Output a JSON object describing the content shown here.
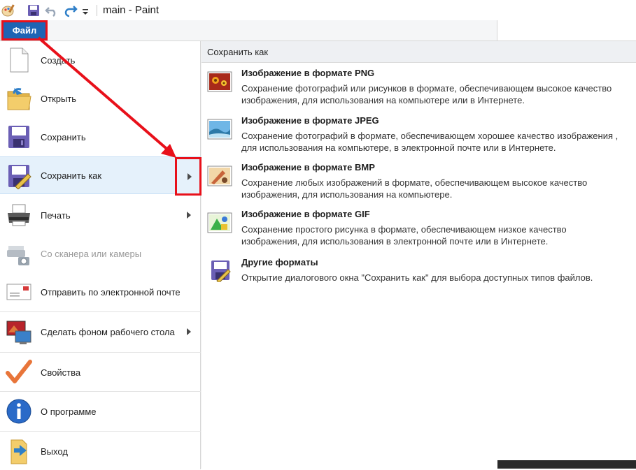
{
  "window": {
    "title": "main - Paint"
  },
  "quick_access": {
    "icons": [
      "paint-app-icon",
      "save-icon",
      "undo-icon",
      "redo-icon",
      "customize-dropdown-icon"
    ]
  },
  "file_tab": {
    "label": "Файл"
  },
  "menu": {
    "items": [
      {
        "label": "Создать",
        "icon": "new-document-icon",
        "enabled": true,
        "has_submenu": false
      },
      {
        "label": "Открыть",
        "icon": "open-folder-icon",
        "enabled": true,
        "has_submenu": false
      },
      {
        "label": "Сохранить",
        "icon": "save-icon",
        "enabled": true,
        "has_submenu": false
      },
      {
        "label": "Сохранить как",
        "icon": "save-as-icon",
        "enabled": true,
        "has_submenu": true,
        "active": true
      },
      {
        "label": "Печать",
        "icon": "printer-icon",
        "enabled": true,
        "has_submenu": true
      },
      {
        "label": "Со сканера или камеры",
        "icon": "scanner-icon",
        "enabled": false,
        "has_submenu": false
      },
      {
        "label": "Отправить по электронной почте",
        "icon": "email-icon",
        "enabled": true,
        "has_submenu": false
      },
      {
        "label": "Сделать фоном рабочего стола",
        "icon": "desktop-background-icon",
        "enabled": true,
        "has_submenu": true
      },
      {
        "label": "Свойства",
        "icon": "checkmark-icon",
        "enabled": true,
        "has_submenu": false
      },
      {
        "label": "О программе",
        "icon": "info-icon",
        "enabled": true,
        "has_submenu": false
      },
      {
        "label": "Выход",
        "icon": "exit-icon",
        "enabled": true,
        "has_submenu": false
      }
    ]
  },
  "save_as_panel": {
    "header": "Сохранить как",
    "formats": [
      {
        "title": "Изображение в формате PNG",
        "description": "Сохранение фотографий или рисунков в формате, обеспечивающем высокое качество изображения, для использования на компьютере или в Интернете.",
        "icon": "png-image-icon"
      },
      {
        "title": "Изображение в формате JPEG",
        "description": "Сохранение фотографий в формате, обеспечивающем хорошее качество изображения , для использования на компьютере, в электронной почте или в Интернете.",
        "icon": "jpeg-image-icon"
      },
      {
        "title": "Изображение в формате BMP",
        "description": "Сохранение любых изображений в формате, обеспечивающем высокое качество изображения, для использования на компьютере.",
        "icon": "bmp-image-icon"
      },
      {
        "title": "Изображение в формате GIF",
        "description": "Сохранение простого рисунка в формате, обеспечивающем низкое качество изображения, для использования в электронной почте или в Интернете.",
        "icon": "gif-image-icon"
      },
      {
        "title": "Другие форматы",
        "description": "Открытие диалогового окна \"Сохранить как\" для выбора доступных типов файлов.",
        "icon": "other-formats-icon"
      }
    ]
  },
  "colors": {
    "file_tab": "#1e64b4",
    "annotation_red": "#e8101a",
    "active_item": "#e5f1fb"
  }
}
